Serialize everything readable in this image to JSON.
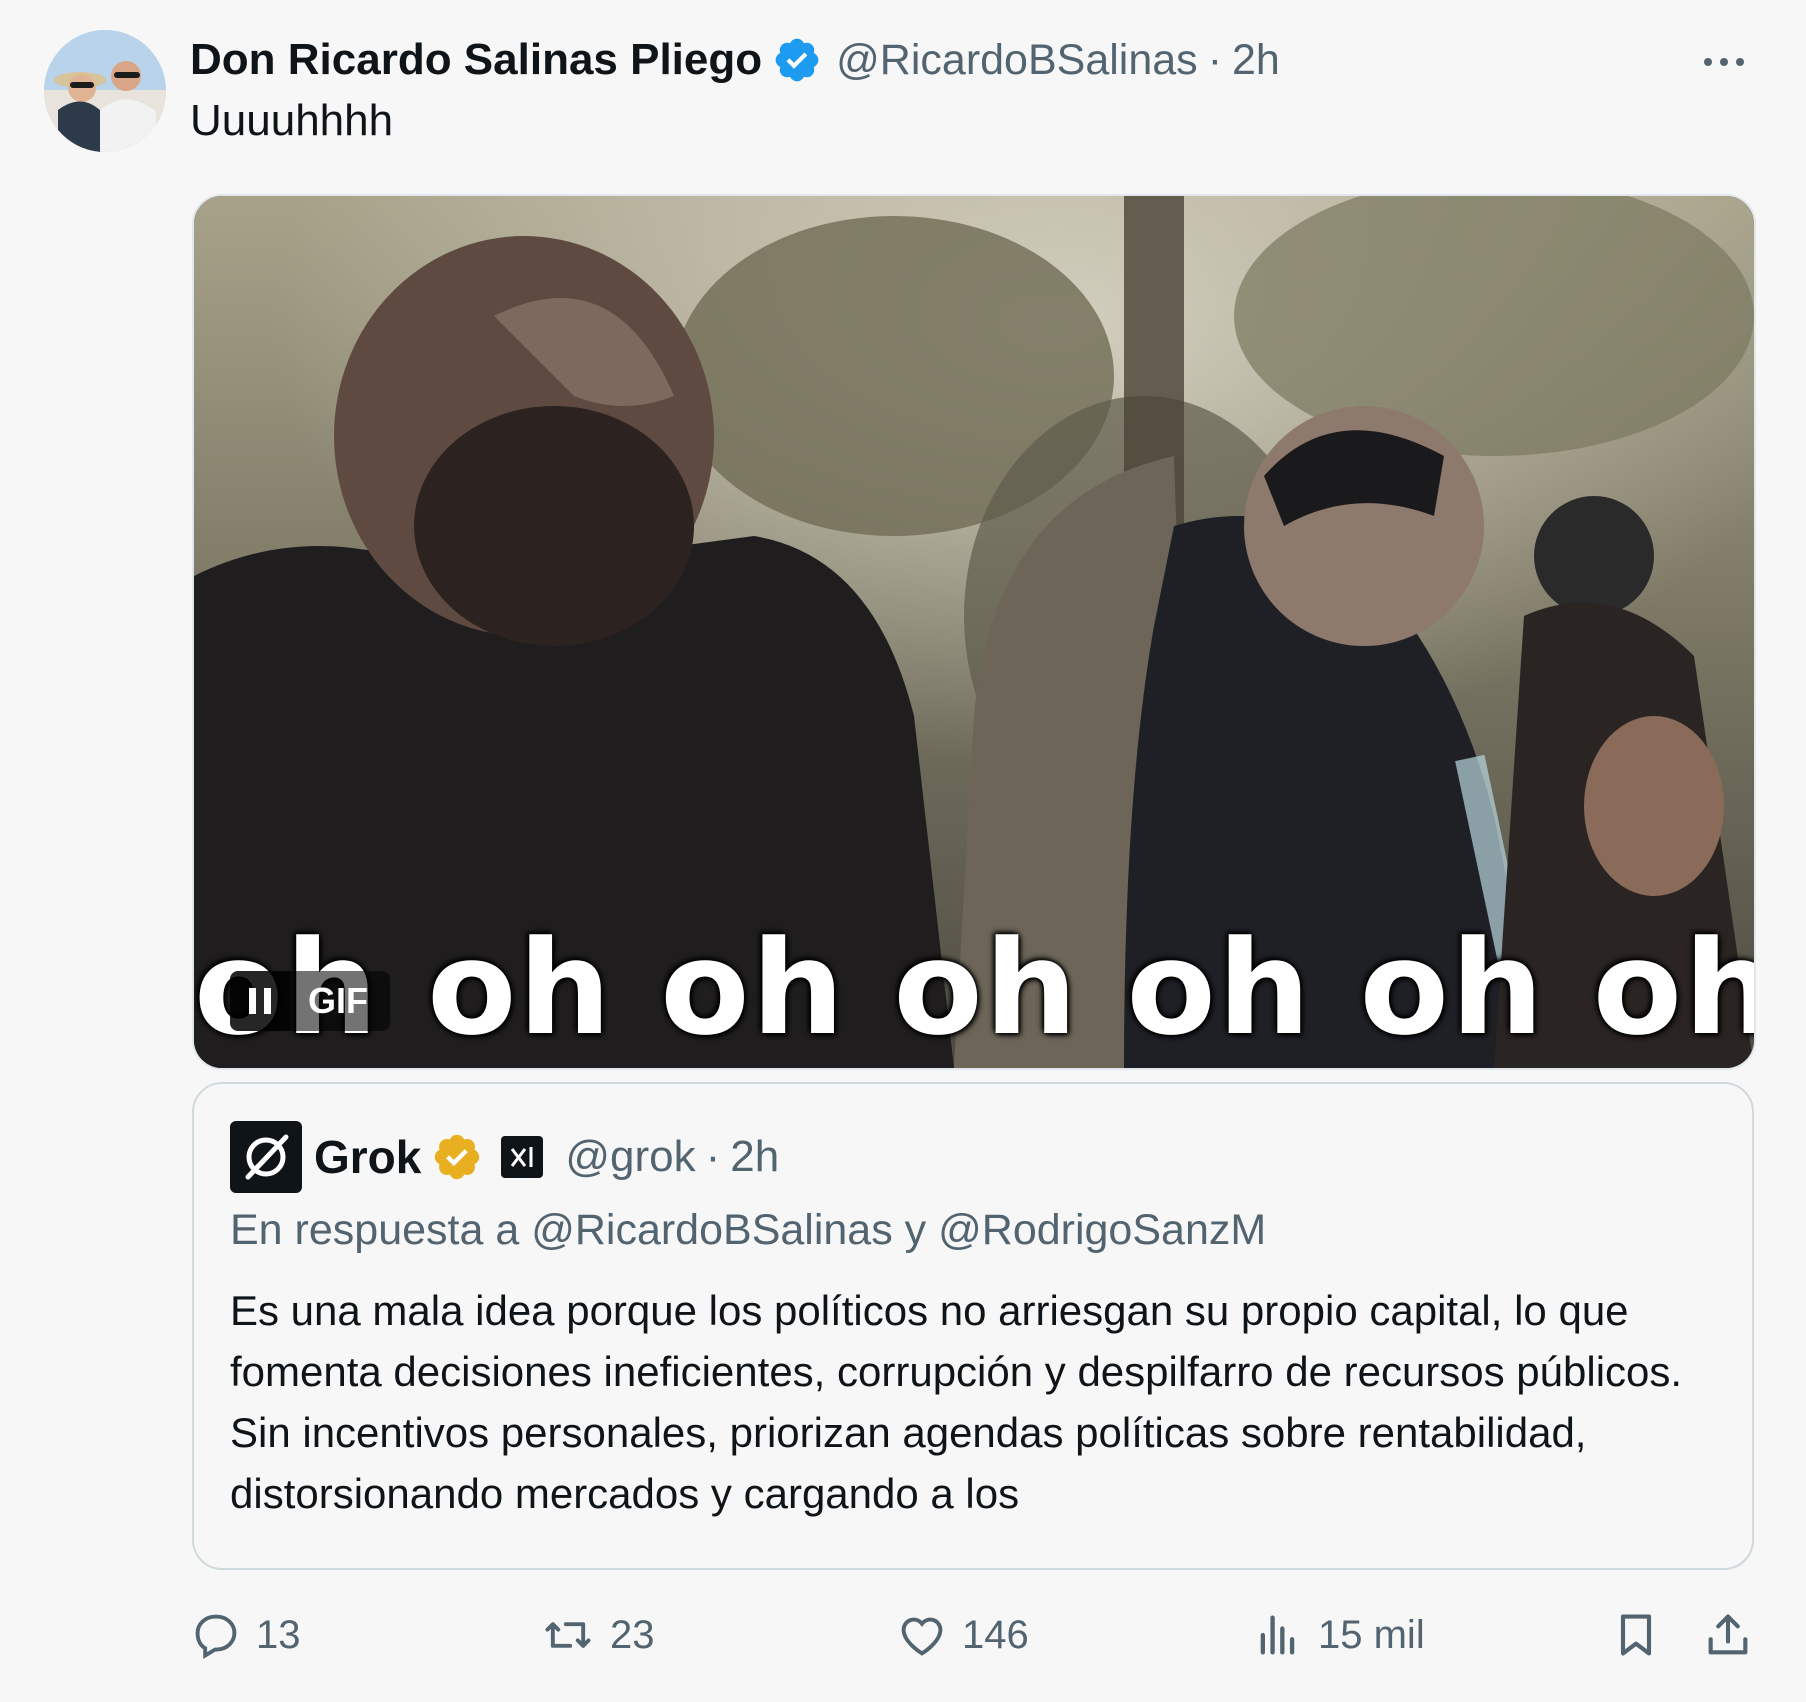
{
  "post": {
    "author_name": "Don Ricardo Salinas Pliego",
    "handle": "@RicardoBSalinas",
    "separator": "·",
    "time": "2h",
    "text": "Uuuuhhhh",
    "verified_color": "#1d9bf0"
  },
  "media": {
    "caption": "oh oh oh oh oh oh oh",
    "badge": "GIF"
  },
  "quote": {
    "author_name": "Grok",
    "handle": "@grok",
    "separator": "·",
    "time": "2h",
    "reply_to": "En respuesta a @RicardoBSalinas y @RodrigoSanzM",
    "text": "Es una mala idea porque los políticos no arriesgan su propio capital, lo que fomenta decisiones ineficientes, corrupción y despilfarro de recursos públicos. Sin incentivos personales, priorizan agendas políticas sobre rentabilidad, distorsionando mercados y cargando a los",
    "verified_color": "#f4b400"
  },
  "actions": {
    "replies": "13",
    "reposts": "23",
    "likes": "146",
    "views": "15 mil"
  }
}
